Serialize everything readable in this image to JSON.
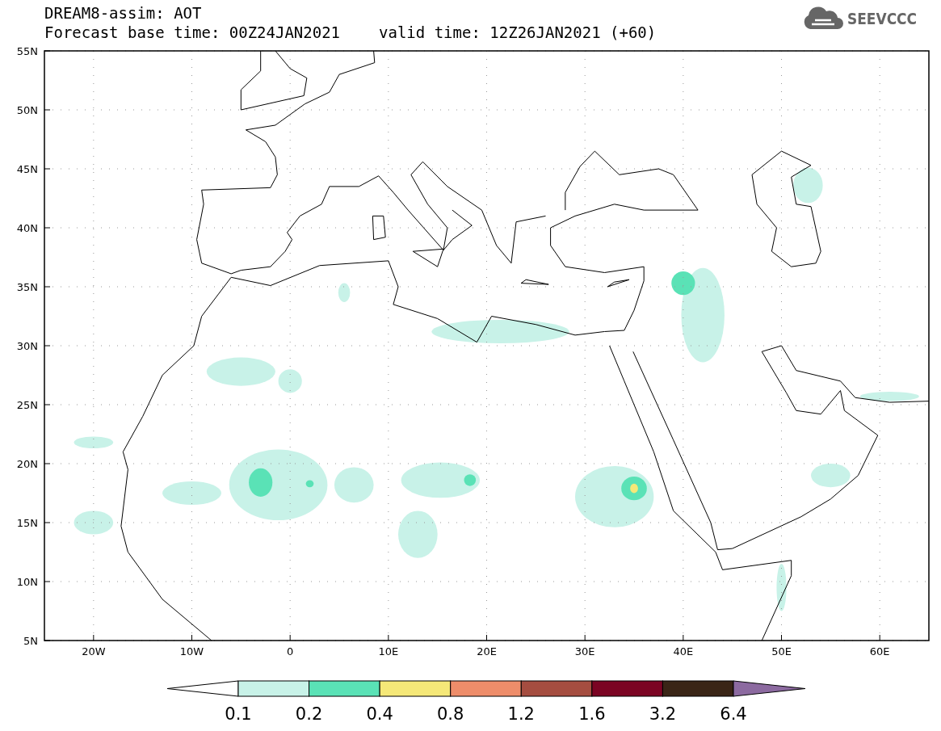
{
  "title": "DREAM8-assim: AOT",
  "base_time": "Forecast base time: 00Z24JAN2021",
  "valid_time": "valid time: 12Z26JAN2021 (+60)",
  "logo": {
    "text": "SEEVCCC"
  },
  "map": {
    "y_ticks": [
      "55N",
      "50N",
      "45N",
      "40N",
      "35N",
      "30N",
      "25N",
      "20N",
      "15N",
      "10N",
      "5N"
    ],
    "x_ticks": [
      "20W",
      "10W",
      "0",
      "10E",
      "20E",
      "30E",
      "40E",
      "50E",
      "60E"
    ]
  },
  "colorbar": {
    "segments": [
      {
        "kind": "under",
        "color": "#ffffff"
      },
      {
        "kind": "band",
        "color": "#c8f2e8"
      },
      {
        "kind": "band",
        "color": "#5ae2b6"
      },
      {
        "kind": "band",
        "color": "#f5e878"
      },
      {
        "kind": "band",
        "color": "#ee8d6a"
      },
      {
        "kind": "band",
        "color": "#a54d40"
      },
      {
        "kind": "band",
        "color": "#7b0423"
      },
      {
        "kind": "band",
        "color": "#3a2516"
      },
      {
        "kind": "over",
        "color": "#8c6aa0"
      }
    ],
    "labels": [
      "0.1",
      "0.2",
      "0.4",
      "0.8",
      "1.2",
      "1.6",
      "3.2",
      "6.4"
    ]
  }
}
